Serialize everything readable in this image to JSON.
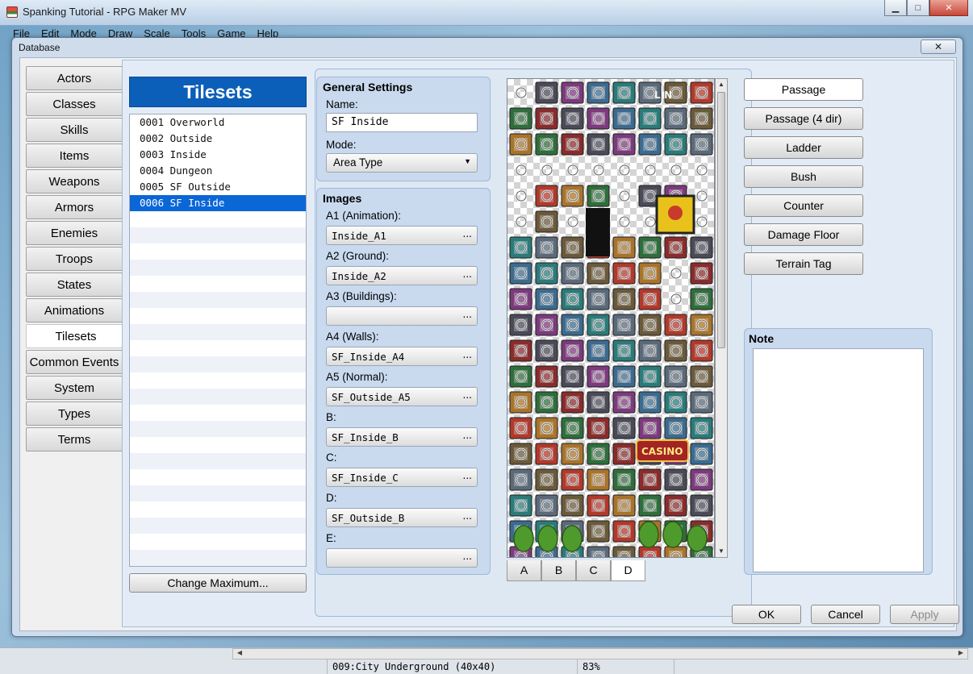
{
  "app": {
    "title": "Spanking Tutorial - RPG Maker MV",
    "menu": [
      "File",
      "Edit",
      "Mode",
      "Draw",
      "Scale",
      "Tools",
      "Game",
      "Help"
    ]
  },
  "window_buttons": {
    "minimize": "▁",
    "maximize": "□",
    "close": "✕"
  },
  "dialog": {
    "title": "Database",
    "close": "✕"
  },
  "categories": [
    "Actors",
    "Classes",
    "Skills",
    "Items",
    "Weapons",
    "Armors",
    "Enemies",
    "Troops",
    "States",
    "Animations",
    "Tilesets",
    "Common Events",
    "System",
    "Types",
    "Terms"
  ],
  "active_category": "Tilesets",
  "list": {
    "header": "Tilesets",
    "items": [
      "0001 Overworld",
      "0002 Outside",
      "0003 Inside",
      "0004 Dungeon",
      "0005 SF Outside",
      "0006 SF Inside"
    ],
    "selected_index": 5,
    "change_max": "Change Maximum..."
  },
  "general": {
    "title": "General Settings",
    "name_label": "Name:",
    "name_value": "SF Inside",
    "mode_label": "Mode:",
    "mode_value": "Area Type"
  },
  "images": {
    "title": "Images",
    "fields": [
      {
        "label": "A1 (Animation):",
        "value": "Inside_A1"
      },
      {
        "label": "A2 (Ground):",
        "value": "Inside_A2"
      },
      {
        "label": "A3 (Buildings):",
        "value": ""
      },
      {
        "label": "A4 (Walls):",
        "value": "SF_Inside_A4"
      },
      {
        "label": "A5 (Normal):",
        "value": "SF_Outside_A5"
      },
      {
        "label": "B:",
        "value": "SF_Inside_B"
      },
      {
        "label": "C:",
        "value": "SF_Inside_C"
      },
      {
        "label": "D:",
        "value": "SF_Outside_B"
      },
      {
        "label": "E:",
        "value": ""
      }
    ],
    "browse": "..."
  },
  "palette": {
    "tabs": [
      "A",
      "B",
      "C",
      "D"
    ],
    "active_tab": "D",
    "signs": [
      "LIN",
      "CASINO"
    ]
  },
  "modes": [
    "Passage",
    "Passage (4 dir)",
    "Ladder",
    "Bush",
    "Counter",
    "Damage Floor",
    "Terrain Tag"
  ],
  "active_mode": "Passage",
  "note": {
    "title": "Note",
    "value": ""
  },
  "footer": {
    "ok": "OK",
    "cancel": "Cancel",
    "apply": "Apply"
  },
  "status": {
    "map": "009:City Underground (40x40)",
    "zoom": "83%"
  }
}
